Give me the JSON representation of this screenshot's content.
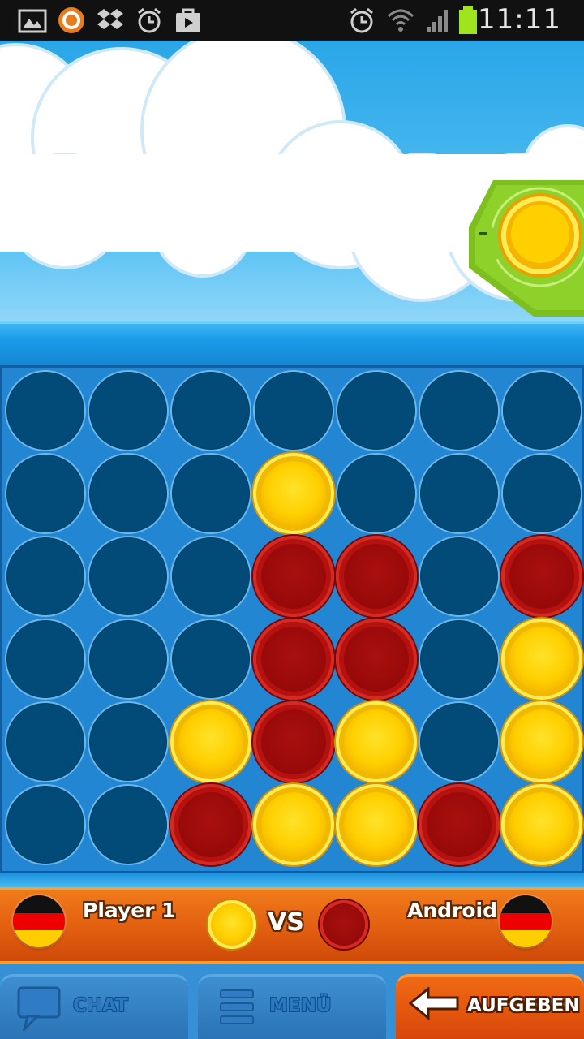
{
  "status_bar": {
    "time": "11:11",
    "left_icons": [
      "gallery-icon",
      "app-notification-icon",
      "dropbox-icon",
      "alarm-clock-icon",
      "play-store-icon"
    ],
    "right_icons": [
      "alarm-icon",
      "wifi-icon",
      "signal-icon",
      "battery-icon"
    ]
  },
  "game": {
    "columns": 7,
    "rows": 6,
    "current_turn": "yellow",
    "board": [
      [
        "empty",
        "empty",
        "empty",
        "empty",
        "empty",
        "empty",
        "empty"
      ],
      [
        "empty",
        "empty",
        "empty",
        "yellow",
        "empty",
        "empty",
        "empty"
      ],
      [
        "empty",
        "empty",
        "empty",
        "red",
        "red",
        "empty",
        "red"
      ],
      [
        "empty",
        "empty",
        "empty",
        "red",
        "red",
        "empty",
        "yellow"
      ],
      [
        "empty",
        "empty",
        "yellow",
        "red",
        "yellow",
        "empty",
        "yellow"
      ],
      [
        "empty",
        "empty",
        "red",
        "yellow",
        "yellow",
        "red",
        "yellow"
      ]
    ]
  },
  "players": {
    "player1": {
      "name": "Player 1",
      "flag": "germany-flag-icon",
      "chip": "yellow"
    },
    "vs_label": "VS",
    "player2": {
      "name": "Android",
      "flag": "germany-flag-icon",
      "chip": "red"
    }
  },
  "buttons": {
    "chat": {
      "label": "CHAT",
      "icon": "chat-bubble-icon"
    },
    "menu": {
      "label": "MENÜ",
      "icon": "menu-icon"
    },
    "give_up": {
      "label": "AUFGEBEN",
      "icon": "arrow-left-icon"
    }
  },
  "colors": {
    "board_blue": "#2386d3",
    "hole": "#024a78",
    "yellow_chip": "#ffd000",
    "red_chip": "#9a0a0a",
    "player_bar": "#e25e10"
  }
}
